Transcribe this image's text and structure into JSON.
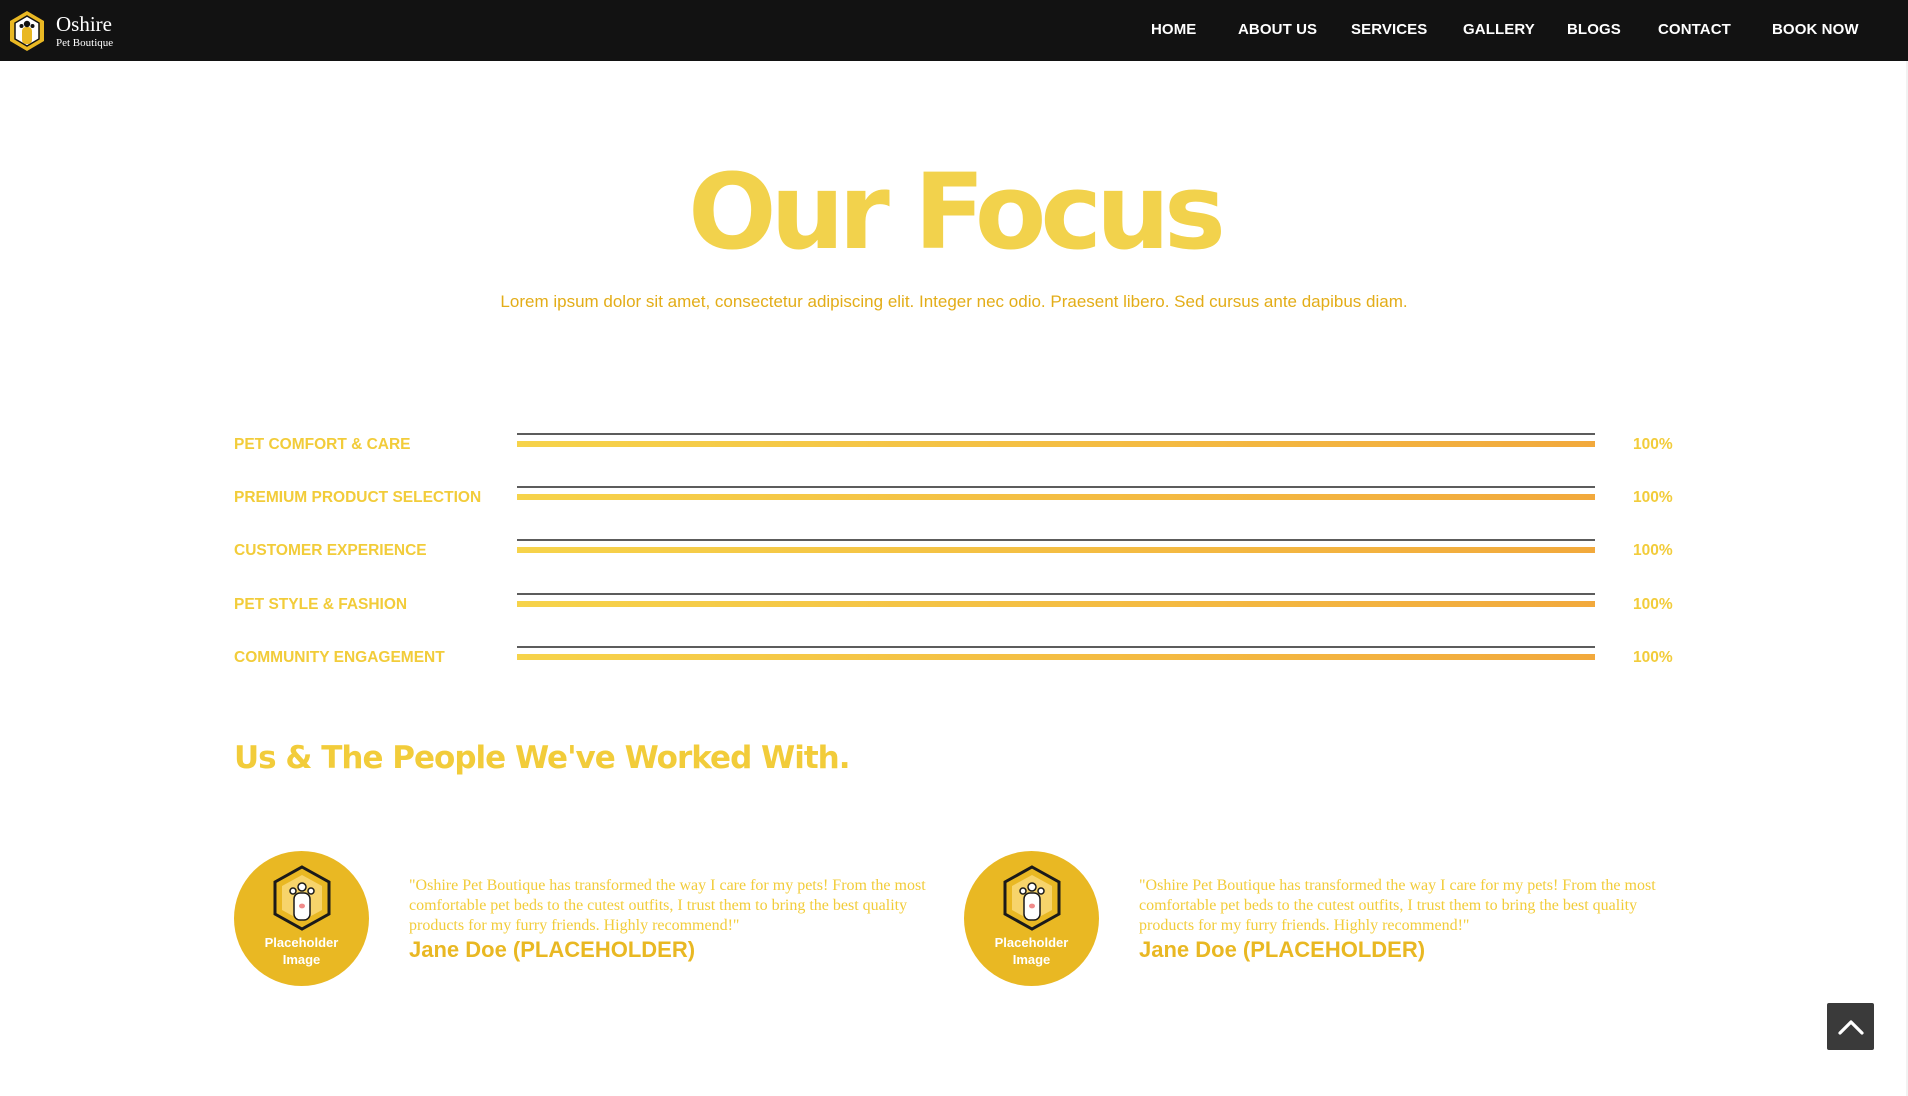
{
  "header": {
    "brand_name": "Oshire",
    "brand_sub": "Pet Boutique",
    "logo_icon": "paw-hexagon-icon",
    "nav": [
      {
        "label": "HOME"
      },
      {
        "label": "ABOUT US"
      },
      {
        "label": "SERVICES"
      },
      {
        "label": "GALLERY"
      },
      {
        "label": "BLOGS"
      },
      {
        "label": "CONTACT"
      },
      {
        "label": "BOOK NOW"
      }
    ]
  },
  "focus": {
    "title": "Our Focus",
    "subtitle": "Lorem ipsum dolor sit amet, consectetur adipiscing elit. Integer nec odio. Praesent libero. Sed cursus ante dapibus diam.",
    "skills": [
      {
        "label": "PET COMFORT & CARE",
        "percent_text": "100%",
        "value": 100
      },
      {
        "label": "PREMIUM PRODUCT SELECTION",
        "percent_text": "100%",
        "value": 100
      },
      {
        "label": "CUSTOMER EXPERIENCE",
        "percent_text": "100%",
        "value": 100
      },
      {
        "label": "PET STYLE & FASHION",
        "percent_text": "100%",
        "value": 100
      },
      {
        "label": "COMMUNITY ENGAGEMENT",
        "percent_text": "100%",
        "value": 100
      }
    ]
  },
  "people": {
    "heading": "Us & The People We've Worked With.",
    "testimonials": [
      {
        "avatar_label_1": "Placeholder",
        "avatar_label_2": "Image",
        "quote": "\"Oshire Pet Boutique has transformed the way I care for my pets! From the most comfortable pet beds to the cutest outfits, I trust them to bring the best quality products for my furry friends. Highly recommend!\"",
        "author": "Jane Doe (PLACEHOLDER)"
      },
      {
        "avatar_label_1": "Placeholder",
        "avatar_label_2": "Image",
        "quote": "\"Oshire Pet Boutique has transformed the way I care for my pets! From the most comfortable pet beds to the cutest outfits, I trust them to bring the best quality products for my furry friends. Highly recommend!\"",
        "author": "Jane Doe (PLACEHOLDER)"
      }
    ]
  },
  "scroll_top": {
    "icon": "chevron-up-icon"
  },
  "colors": {
    "header_bg": "#121212",
    "accent_yellow": "#f2d24c",
    "accent_gold": "#e9b823",
    "bar_gradient_end": "#f2a93c"
  }
}
